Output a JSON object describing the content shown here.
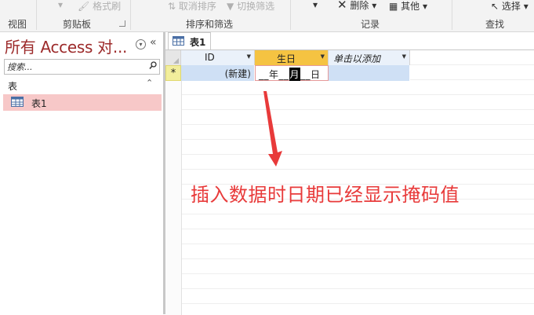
{
  "ribbon": {
    "items": {
      "format_painter": "格式刷",
      "clear_sort": "取消排序",
      "toggle_filter": "切换筛选",
      "delete": "删除",
      "more": "其他",
      "select": "选择"
    },
    "groups": {
      "view": "视图",
      "clipboard": "剪贴板",
      "sort_filter": "排序和筛选",
      "records": "记录",
      "find": "查找"
    }
  },
  "nav": {
    "title": "所有 Access 对...",
    "search_placeholder": "搜索...",
    "group_label": "表",
    "items": [
      {
        "label": "表1",
        "selected": true
      }
    ]
  },
  "document_tab": {
    "label": "表1"
  },
  "datasheet": {
    "columns": [
      {
        "label": "ID",
        "italic": false
      },
      {
        "label": "生日",
        "italic": false,
        "active": true
      },
      {
        "label": "单击以添加",
        "italic": true
      }
    ],
    "new_record": {
      "selector_symbol": "*",
      "id_value": "(新建)",
      "date_mask_pre": "__年__",
      "date_mask_cursor": "月",
      "date_mask_post": "__日"
    }
  },
  "annotation": {
    "text": "插入数据时日期已经显示掩码值",
    "color": "#e83a3a"
  },
  "colors": {
    "nav_title": "#9c2a2a",
    "selected_item": "#f7c8c8",
    "active_header": "#f5c342",
    "new_row": "#cfe0f5"
  }
}
